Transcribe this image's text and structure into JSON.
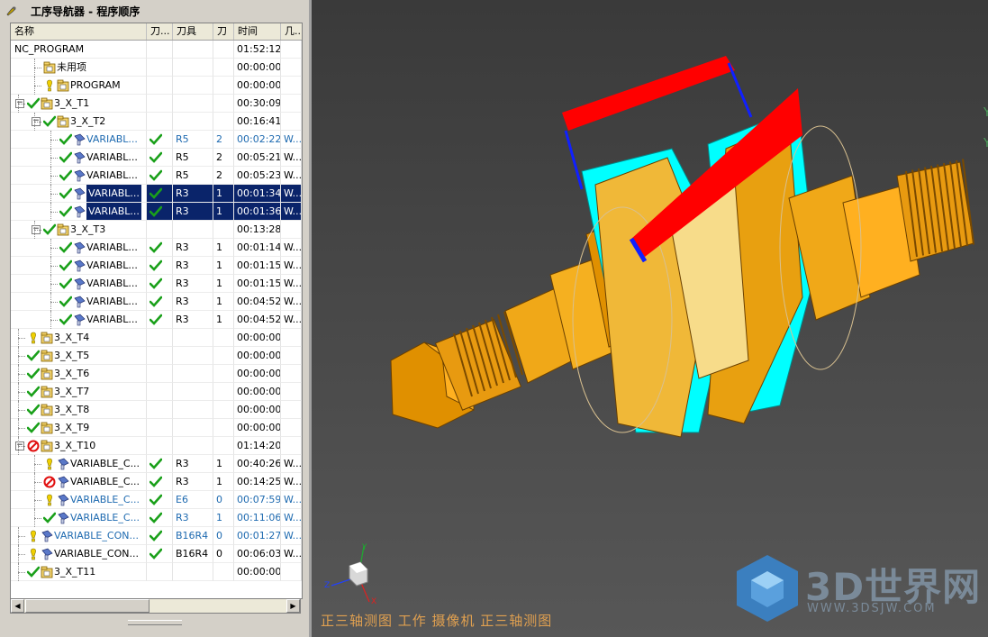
{
  "navigator": {
    "title": "工序导航器 - 程序顺序"
  },
  "columns": [
    "名称",
    "刀...",
    "刀具",
    "刀",
    "时间",
    "几..."
  ],
  "rows": [
    {
      "name": "NC_PROGRAM",
      "indent": 0,
      "exp": "",
      "status": "",
      "type": "root",
      "tool": "",
      "tn": "",
      "time": "01:52:12",
      "geo": "",
      "blue": false,
      "sel": false
    },
    {
      "name": "未用项",
      "indent": 1,
      "exp": "",
      "status": "",
      "type": "group",
      "tool": "",
      "tn": "",
      "time": "00:00:00",
      "geo": "",
      "blue": false,
      "sel": false
    },
    {
      "name": "PROGRAM",
      "indent": 1,
      "exp": "",
      "status": "warn",
      "type": "group",
      "tool": "",
      "tn": "",
      "time": "00:00:00",
      "geo": "",
      "blue": false,
      "sel": false
    },
    {
      "name": "3_X_T1",
      "indent": 0,
      "exp": "-",
      "status": "ok",
      "type": "group",
      "tool": "",
      "tn": "",
      "time": "00:30:09",
      "geo": "",
      "blue": false,
      "sel": false
    },
    {
      "name": "3_X_T2",
      "indent": 1,
      "exp": "-",
      "status": "ok",
      "type": "group",
      "tool": "",
      "tn": "",
      "time": "00:16:41",
      "geo": "",
      "blue": false,
      "sel": false
    },
    {
      "name": "VARIABL...",
      "indent": 2,
      "exp": "",
      "status": "ok",
      "type": "op",
      "path": "ok",
      "tool": "R5",
      "tn": "2",
      "time": "00:02:22",
      "geo": "W...",
      "blue": true,
      "sel": false
    },
    {
      "name": "VARIABL...",
      "indent": 2,
      "exp": "",
      "status": "ok",
      "type": "op",
      "path": "ok",
      "tool": "R5",
      "tn": "2",
      "time": "00:05:21",
      "geo": "W...",
      "blue": false,
      "sel": false
    },
    {
      "name": "VARIABL...",
      "indent": 2,
      "exp": "",
      "status": "ok",
      "type": "op",
      "path": "ok",
      "tool": "R5",
      "tn": "2",
      "time": "00:05:23",
      "geo": "W...",
      "blue": false,
      "sel": false
    },
    {
      "name": "VARIABL...",
      "indent": 2,
      "exp": "",
      "status": "ok",
      "type": "op",
      "path": "ok",
      "tool": "R3",
      "tn": "1",
      "time": "00:01:34",
      "geo": "W...",
      "blue": false,
      "sel": true
    },
    {
      "name": "VARIABL...",
      "indent": 2,
      "exp": "",
      "status": "ok",
      "type": "op",
      "path": "ok",
      "tool": "R3",
      "tn": "1",
      "time": "00:01:36",
      "geo": "W...",
      "blue": false,
      "sel": true
    },
    {
      "name": "3_X_T3",
      "indent": 1,
      "exp": "-",
      "status": "ok",
      "type": "group",
      "tool": "",
      "tn": "",
      "time": "00:13:28",
      "geo": "",
      "blue": false,
      "sel": false
    },
    {
      "name": "VARIABL...",
      "indent": 2,
      "exp": "",
      "status": "ok",
      "type": "op",
      "path": "ok",
      "tool": "R3",
      "tn": "1",
      "time": "00:01:14",
      "geo": "W...",
      "blue": false,
      "sel": false
    },
    {
      "name": "VARIABL...",
      "indent": 2,
      "exp": "",
      "status": "ok",
      "type": "op",
      "path": "ok",
      "tool": "R3",
      "tn": "1",
      "time": "00:01:15",
      "geo": "W...",
      "blue": false,
      "sel": false
    },
    {
      "name": "VARIABL...",
      "indent": 2,
      "exp": "",
      "status": "ok",
      "type": "op",
      "path": "ok",
      "tool": "R3",
      "tn": "1",
      "time": "00:01:15",
      "geo": "W...",
      "blue": false,
      "sel": false
    },
    {
      "name": "VARIABL...",
      "indent": 2,
      "exp": "",
      "status": "ok",
      "type": "op",
      "path": "ok",
      "tool": "R3",
      "tn": "1",
      "time": "00:04:52",
      "geo": "W...",
      "blue": false,
      "sel": false
    },
    {
      "name": "VARIABL...",
      "indent": 2,
      "exp": "",
      "status": "ok",
      "type": "op",
      "path": "ok",
      "tool": "R3",
      "tn": "1",
      "time": "00:04:52",
      "geo": "W...",
      "blue": false,
      "sel": false
    },
    {
      "name": "3_X_T4",
      "indent": 0,
      "exp": "",
      "status": "warn",
      "type": "group",
      "tool": "",
      "tn": "",
      "time": "00:00:00",
      "geo": "",
      "blue": false,
      "sel": false
    },
    {
      "name": "3_X_T5",
      "indent": 0,
      "exp": "",
      "status": "ok",
      "type": "group",
      "tool": "",
      "tn": "",
      "time": "00:00:00",
      "geo": "",
      "blue": false,
      "sel": false
    },
    {
      "name": "3_X_T6",
      "indent": 0,
      "exp": "",
      "status": "ok",
      "type": "group",
      "tool": "",
      "tn": "",
      "time": "00:00:00",
      "geo": "",
      "blue": false,
      "sel": false
    },
    {
      "name": "3_X_T7",
      "indent": 0,
      "exp": "",
      "status": "ok",
      "type": "group",
      "tool": "",
      "tn": "",
      "time": "00:00:00",
      "geo": "",
      "blue": false,
      "sel": false
    },
    {
      "name": "3_X_T8",
      "indent": 0,
      "exp": "",
      "status": "ok",
      "type": "group",
      "tool": "",
      "tn": "",
      "time": "00:00:00",
      "geo": "",
      "blue": false,
      "sel": false
    },
    {
      "name": "3_X_T9",
      "indent": 0,
      "exp": "",
      "status": "ok",
      "type": "group",
      "tool": "",
      "tn": "",
      "time": "00:00:00",
      "geo": "",
      "blue": false,
      "sel": false
    },
    {
      "name": "3_X_T10",
      "indent": 0,
      "exp": "-",
      "status": "no",
      "type": "group",
      "tool": "",
      "tn": "",
      "time": "01:14:20",
      "geo": "",
      "blue": false,
      "sel": false
    },
    {
      "name": "VARIABLE_C...",
      "indent": 1,
      "exp": "",
      "status": "warn",
      "type": "op",
      "path": "ok",
      "tool": "R3",
      "tn": "1",
      "time": "00:40:26",
      "geo": "W...",
      "blue": false,
      "sel": false
    },
    {
      "name": "VARIABLE_C...",
      "indent": 1,
      "exp": "",
      "status": "no",
      "type": "op",
      "path": "ok",
      "tool": "R3",
      "tn": "1",
      "time": "00:14:25",
      "geo": "W...",
      "blue": false,
      "sel": false
    },
    {
      "name": "VARIABLE_C...",
      "indent": 1,
      "exp": "",
      "status": "warn",
      "type": "op",
      "path": "ok",
      "tool": "E6",
      "tn": "0",
      "time": "00:07:59",
      "geo": "W...",
      "blue": true,
      "sel": false
    },
    {
      "name": "VARIABLE_C...",
      "indent": 1,
      "exp": "",
      "status": "ok",
      "type": "op",
      "path": "ok",
      "tool": "R3",
      "tn": "1",
      "time": "00:11:06",
      "geo": "W...",
      "blue": true,
      "sel": false
    },
    {
      "name": "VARIABLE_CON...",
      "indent": 0,
      "exp": "",
      "status": "warn",
      "type": "op",
      "path": "ok",
      "tool": "B16R4",
      "tn": "0",
      "time": "00:01:27",
      "geo": "W...",
      "blue": true,
      "sel": false
    },
    {
      "name": "VARIABLE_CON...",
      "indent": 0,
      "exp": "",
      "status": "warn",
      "type": "op",
      "path": "ok",
      "tool": "B16R4",
      "tn": "0",
      "time": "00:06:03",
      "geo": "W...",
      "blue": false,
      "sel": false
    },
    {
      "name": "3_X_T11",
      "indent": 0,
      "exp": "",
      "status": "ok",
      "type": "group",
      "tool": "",
      "tn": "",
      "time": "00:00:00",
      "geo": "",
      "blue": false,
      "sel": false
    }
  ],
  "viewport": {
    "status_text": "正三轴测图  工作  摄像机  正三轴测图",
    "edge_labels": [
      "Y",
      "Y"
    ],
    "triad_labels": {
      "y": "Y",
      "z": "Z",
      "x": "X"
    },
    "watermark": {
      "logo_text": "3D世界网",
      "url": "WWW.3DSJW.COM"
    },
    "colors": {
      "part": "#e8a010",
      "surface": "#00ffff",
      "toolpath_red": "#ff0000",
      "toolpath_blue": "#1020ff"
    }
  }
}
